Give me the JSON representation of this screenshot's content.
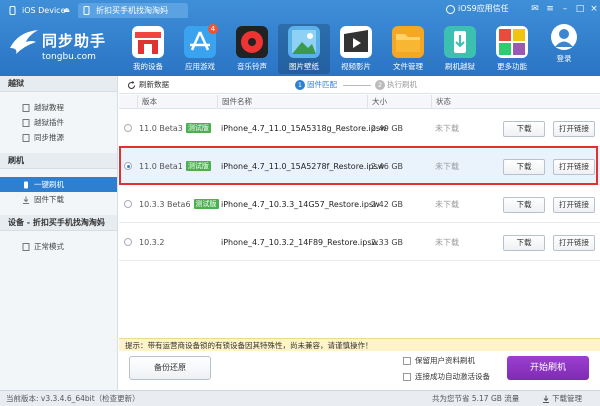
{
  "tabs": [
    {
      "label": "iOS Device"
    },
    {
      "label": "折扣买手机找淘淘妈"
    }
  ],
  "trust_label": "iOS9应用信任",
  "logo": {
    "name": "同步助手",
    "url": "tongbu.com"
  },
  "nav": [
    {
      "label": "我的设备",
      "icon": "device-icon"
    },
    {
      "label": "应用游戏",
      "icon": "app-store-icon",
      "badge": "4"
    },
    {
      "label": "音乐铃声",
      "icon": "music-icon"
    },
    {
      "label": "图片壁纸",
      "icon": "picture-icon"
    },
    {
      "label": "视频影片",
      "icon": "video-icon"
    },
    {
      "label": "文件管理",
      "icon": "folder-icon"
    },
    {
      "label": "刷机越狱",
      "icon": "flash-icon"
    },
    {
      "label": "更多功能",
      "icon": "more-icon"
    }
  ],
  "login_label": "登录",
  "sidebar": {
    "sections": [
      {
        "title": "越狱",
        "items": [
          {
            "label": "越狱教程"
          },
          {
            "label": "越狱插件"
          },
          {
            "label": "同步推源"
          }
        ]
      },
      {
        "title": "刷机",
        "items": [
          {
            "label": "一键刷机"
          },
          {
            "label": "固件下载"
          }
        ]
      },
      {
        "title": "设备 - 折扣买手机找淘淘妈",
        "items": [
          {
            "label": "正常模式"
          }
        ]
      }
    ]
  },
  "toolbar": {
    "refresh": "刷新数据",
    "step1_num": "1",
    "step1": "固件匹配",
    "step2_num": "2",
    "step2": "执行刷机"
  },
  "columns": [
    "版本",
    "固件名称",
    "大小",
    "状态"
  ],
  "rows": [
    {
      "version": "11.0 Beta3",
      "tag": "测试版",
      "file": "iPhone_4.7_11.0_15A5318g_Restore.ipsw",
      "size": "2.49 GB",
      "status": "未下载",
      "selected": false
    },
    {
      "version": "11.0 Beta1",
      "tag": "测试版",
      "file": "iPhone_4.7_11.0_15A5278f_Restore.ipsw",
      "size": "2.46 GB",
      "status": "未下载",
      "selected": true
    },
    {
      "version": "10.3.3 Beta6",
      "tag": "测试版",
      "file": "iPhone_4.7_10.3.3_14G57_Restore.ipsw",
      "size": "2.42 GB",
      "status": "未下载",
      "selected": false
    },
    {
      "version": "10.3.2",
      "tag": "",
      "file": "iPhone_4.7_10.3.2_14F89_Restore.ipsw",
      "size": "2.33 GB",
      "status": "未下载",
      "selected": false
    }
  ],
  "row_buttons": {
    "download": "下载",
    "open_link": "打开链接"
  },
  "tip": "提示：带有运营商设备锁的有锁设备因其特殊性，尚未兼容，请谨慎操作！",
  "bottom": {
    "restore": "备份还原",
    "keep_data": "保留用户资料刷机",
    "auto_activate": "连接成功自动激活设备",
    "start": "开始刷机"
  },
  "status": {
    "version": "当前版本: v3.3.4.6_64bit（检查更新）",
    "saved": "共为您节省 5.17 GB 流量",
    "download": "下载管理"
  }
}
